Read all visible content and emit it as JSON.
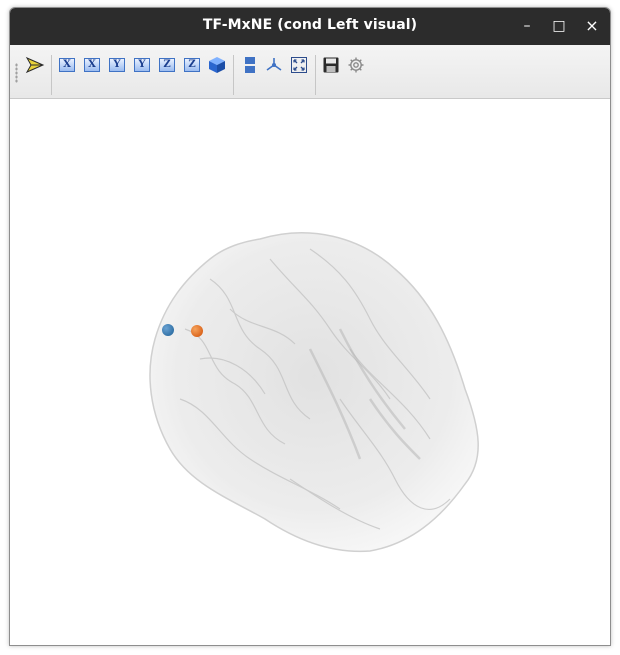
{
  "window": {
    "title": "TF-MxNE (cond Left visual)"
  },
  "titlebar": {
    "minimize_glyph": "–",
    "maximize_glyph": "□",
    "close_glyph": "×"
  },
  "toolbar": {
    "buttons": [
      {
        "name": "select-mode-icon"
      },
      {
        "name": "view-x-plus-button",
        "label": "X"
      },
      {
        "name": "view-x-minus-button",
        "label": "X"
      },
      {
        "name": "view-y-plus-button",
        "label": "Y"
      },
      {
        "name": "view-y-minus-button",
        "label": "Y"
      },
      {
        "name": "view-z-plus-button",
        "label": "Z"
      },
      {
        "name": "view-z-minus-button",
        "label": "Z"
      },
      {
        "name": "isometric-view-icon"
      },
      {
        "name": "full-screen-icon"
      },
      {
        "name": "axes-icon"
      },
      {
        "name": "fit-view-icon"
      },
      {
        "name": "save-icon"
      },
      {
        "name": "settings-icon"
      }
    ]
  },
  "scene": {
    "brain_color": "#d4d4d4",
    "dipoles": [
      {
        "name": "dipole-1",
        "color": "#2f6fa4"
      },
      {
        "name": "dipole-2",
        "color": "#e8731f"
      }
    ]
  }
}
